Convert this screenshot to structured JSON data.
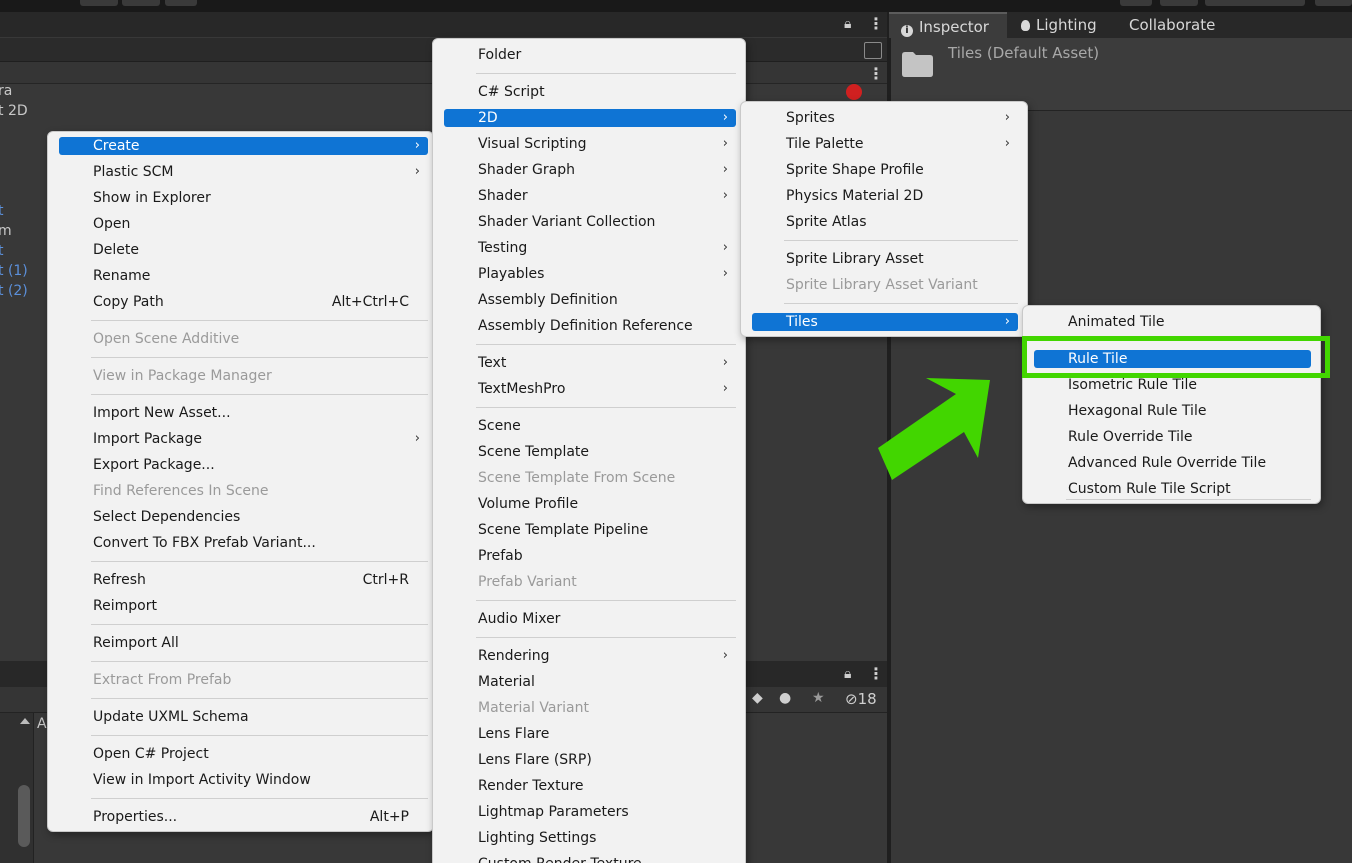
{
  "inspector": {
    "tabs": [
      "Inspector",
      "Lighting",
      "Collaborate"
    ],
    "asset_title": "Tiles (Default Asset)"
  },
  "hierarchy_partial": [
    "ra",
    "t 2D",
    "t",
    "m",
    "t",
    "t (1)",
    "t (2)"
  ],
  "bottom_panel": {
    "hidden_count": "18",
    "col_label": "A"
  },
  "context_menu": {
    "items": [
      {
        "label": "Create",
        "selected": true,
        "submenu": true
      },
      {
        "label": "Plastic SCM",
        "submenu": true
      },
      {
        "label": "Show in Explorer"
      },
      {
        "label": "Open"
      },
      {
        "label": "Delete"
      },
      {
        "label": "Rename"
      },
      {
        "label": "Copy Path",
        "shortcut": "Alt+Ctrl+C"
      },
      {
        "label": "Open Scene Additive",
        "disabled": true
      },
      {
        "label": "View in Package Manager",
        "disabled": true
      },
      {
        "label": "Import New Asset..."
      },
      {
        "label": "Import Package",
        "submenu": true
      },
      {
        "label": "Export Package..."
      },
      {
        "label": "Find References In Scene",
        "disabled": true
      },
      {
        "label": "Select Dependencies"
      },
      {
        "label": "Convert To FBX Prefab Variant..."
      },
      {
        "label": "Refresh",
        "shortcut": "Ctrl+R"
      },
      {
        "label": "Reimport"
      },
      {
        "label": "Reimport All"
      },
      {
        "label": "Extract From Prefab",
        "disabled": true
      },
      {
        "label": "Update UXML Schema"
      },
      {
        "label": "Open C# Project"
      },
      {
        "label": "View in Import Activity Window"
      },
      {
        "label": "Properties...",
        "shortcut": "Alt+P"
      }
    ]
  },
  "create_menu": {
    "items": [
      {
        "label": "Folder"
      },
      {
        "label": "C# Script"
      },
      {
        "label": "2D",
        "selected": true,
        "submenu": true
      },
      {
        "label": "Visual Scripting",
        "submenu": true
      },
      {
        "label": "Shader Graph",
        "submenu": true
      },
      {
        "label": "Shader",
        "submenu": true
      },
      {
        "label": "Shader Variant Collection"
      },
      {
        "label": "Testing",
        "submenu": true
      },
      {
        "label": "Playables",
        "submenu": true
      },
      {
        "label": "Assembly Definition"
      },
      {
        "label": "Assembly Definition Reference"
      },
      {
        "label": "Text",
        "submenu": true
      },
      {
        "label": "TextMeshPro",
        "submenu": true
      },
      {
        "label": "Scene"
      },
      {
        "label": "Scene Template"
      },
      {
        "label": "Scene Template From Scene",
        "disabled": true
      },
      {
        "label": "Volume Profile"
      },
      {
        "label": "Scene Template Pipeline"
      },
      {
        "label": "Prefab"
      },
      {
        "label": "Prefab Variant",
        "disabled": true
      },
      {
        "label": "Audio Mixer"
      },
      {
        "label": "Rendering",
        "submenu": true
      },
      {
        "label": "Material"
      },
      {
        "label": "Material Variant",
        "disabled": true
      },
      {
        "label": "Lens Flare"
      },
      {
        "label": "Lens Flare (SRP)"
      },
      {
        "label": "Render Texture"
      },
      {
        "label": "Lightmap Parameters"
      },
      {
        "label": "Lighting Settings"
      },
      {
        "label": "Custom Render Texture"
      }
    ]
  },
  "menu_2d": {
    "items": [
      {
        "label": "Sprites",
        "submenu": true
      },
      {
        "label": "Tile Palette",
        "submenu": true
      },
      {
        "label": "Sprite Shape Profile"
      },
      {
        "label": "Physics Material 2D"
      },
      {
        "label": "Sprite Atlas"
      },
      {
        "label": "Sprite Library Asset"
      },
      {
        "label": "Sprite Library Asset Variant",
        "disabled": true
      },
      {
        "label": "Tiles",
        "selected": true,
        "submenu": true
      }
    ]
  },
  "menu_tiles": {
    "items": [
      {
        "label": "Animated Tile"
      },
      {
        "label": "Rule Tile",
        "selected": true
      },
      {
        "label": "Isometric Rule Tile"
      },
      {
        "label": "Hexagonal Rule Tile"
      },
      {
        "label": "Rule Override Tile"
      },
      {
        "label": "Advanced Rule Override Tile"
      },
      {
        "label": "Custom Rule Tile Script"
      }
    ]
  },
  "colors": {
    "selection": "#0f74d4",
    "highlight": "#42d600",
    "menu_bg": "#f2f2f2",
    "editor_bg": "#383838"
  },
  "submenu_arrow": "›"
}
